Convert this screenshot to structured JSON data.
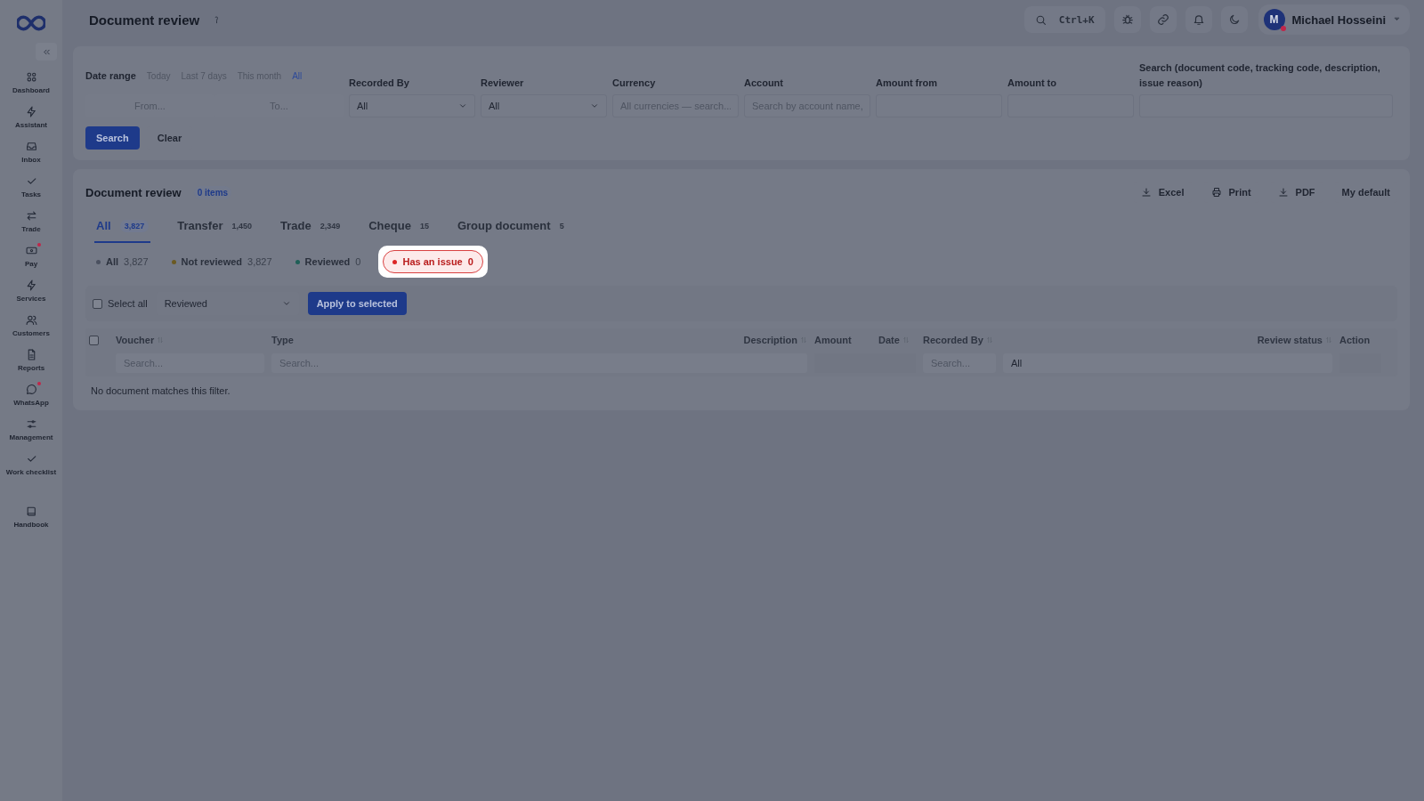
{
  "sidebar": {
    "items": [
      {
        "label": "Dashboard",
        "badge": false
      },
      {
        "label": "Assistant",
        "badge": false
      },
      {
        "label": "Inbox",
        "badge": false
      },
      {
        "label": "Tasks",
        "badge": false
      },
      {
        "label": "Trade",
        "badge": false
      },
      {
        "label": "Pay",
        "badge": true
      },
      {
        "label": "Services",
        "badge": false
      },
      {
        "label": "Customers",
        "badge": false
      },
      {
        "label": "Reports",
        "badge": false
      },
      {
        "label": "WhatsApp",
        "badge": true
      },
      {
        "label": "Management",
        "badge": false
      },
      {
        "label": "Work checklist",
        "badge": false
      },
      {
        "label": "Handbook",
        "badge": false
      }
    ]
  },
  "header": {
    "title": "Document review",
    "search_shortcut": "Ctrl+K",
    "user": {
      "initial": "M",
      "name": "Michael Hosseini",
      "badge": true
    }
  },
  "filters": {
    "date_range": {
      "label": "Date range",
      "presets": [
        {
          "label": "Today",
          "selected": false
        },
        {
          "label": "Last 7 days",
          "selected": false
        },
        {
          "label": "This month",
          "selected": false
        },
        {
          "label": "All",
          "selected": true
        }
      ],
      "from_placeholder": "From...",
      "to_placeholder": "To..."
    },
    "fields": [
      {
        "kind": "select",
        "label": "Recorded By",
        "value": "All"
      },
      {
        "kind": "select",
        "label": "Reviewer",
        "value": "All"
      },
      {
        "kind": "input",
        "label": "Currency",
        "placeholder": "All currencies — search..."
      },
      {
        "kind": "input",
        "label": "Account",
        "placeholder": "Search by account name,"
      },
      {
        "kind": "input",
        "label": "Amount from"
      },
      {
        "kind": "input",
        "label": "Amount to"
      },
      {
        "kind": "input",
        "label": "Search (document code, tracking code, description, issue reason)"
      }
    ],
    "buttons": [
      "Search",
      "Clear"
    ]
  },
  "review": {
    "title": "Document review",
    "count": "0 items",
    "actions": [
      {
        "kind": "download",
        "label": "Excel"
      },
      {
        "kind": "print",
        "label": "Print"
      },
      {
        "kind": "download",
        "label": "PDF"
      },
      {
        "kind": "plain",
        "label": "My default"
      }
    ],
    "tabs": [
      {
        "label": "All",
        "count": "3,827",
        "selected": true
      },
      {
        "label": "Transfer",
        "count": "1,450",
        "selected": false
      },
      {
        "label": "Trade",
        "count": "2,349",
        "selected": false
      },
      {
        "label": "Cheque",
        "count": "15",
        "selected": false
      },
      {
        "label": "Group document",
        "count": "5",
        "selected": false
      }
    ],
    "status_filters": [
      {
        "label": "All",
        "count": "3,827",
        "color": "#4b5160",
        "selected": false
      },
      {
        "label": "Not reviewed",
        "count": "3,827",
        "color": "#6b5a22",
        "selected": false
      },
      {
        "label": "Reviewed",
        "count": "0",
        "color": "#1f5f57",
        "selected": false
      },
      {
        "label": "Has an issue",
        "count": "0",
        "color": "#dc2626",
        "selected": true
      }
    ],
    "bulk": {
      "select_all": "Select all",
      "checked": false,
      "status_value": "Reviewed",
      "apply": "Apply to selected"
    },
    "table": {
      "header_checked": false,
      "columns": [
        {
          "label": "Voucher",
          "sortable": true
        },
        {
          "label": "Type",
          "sortable": false
        },
        {
          "label": "Description",
          "sortable": true
        },
        {
          "label": "Amount",
          "sortable": false
        },
        {
          "label": "Date",
          "sortable": true
        },
        {
          "label": "Recorded By",
          "sortable": true
        },
        {
          "label": "Review status",
          "sortable": true
        },
        {
          "label": "Action",
          "sortable": false
        }
      ],
      "filter_row": [
        {
          "kind": "search",
          "placeholder": "Search..."
        },
        {
          "kind": "search",
          "placeholder": "Search..."
        },
        {
          "kind": "blank"
        },
        {
          "kind": "search",
          "placeholder": "Search..."
        },
        {
          "kind": "select",
          "value": "All"
        },
        {
          "kind": "blank"
        }
      ],
      "empty_message": "No document matches this filter."
    }
  }
}
